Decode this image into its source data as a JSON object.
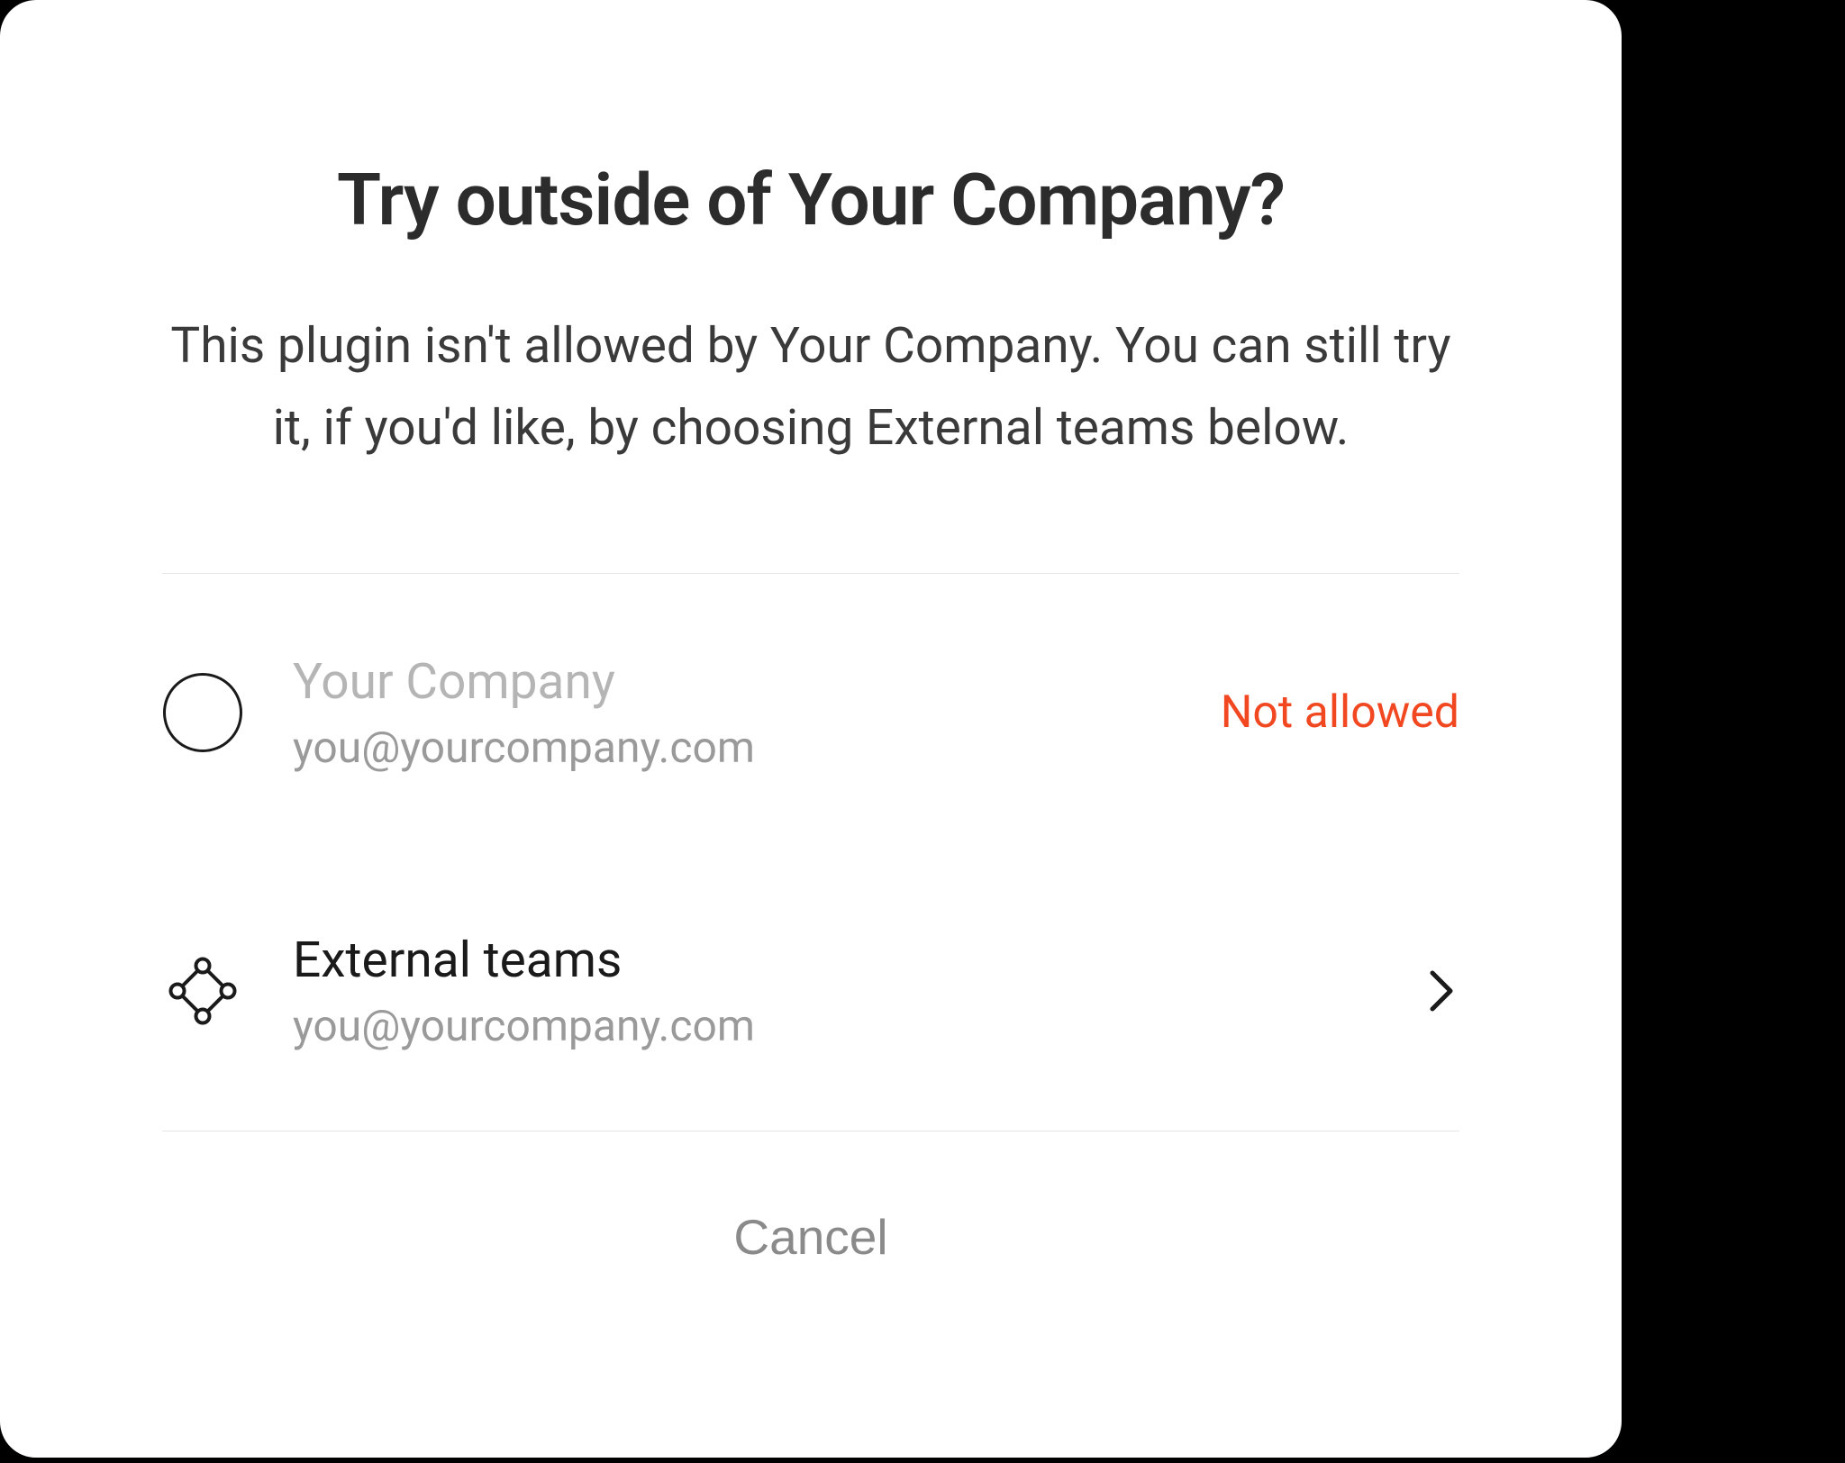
{
  "modal": {
    "title": "Try outside of Your Company?",
    "description": "This plugin isn't allowed by Your Company. You can still try it, if you'd like, by choosing External teams below.",
    "options": [
      {
        "icon": "circle",
        "title": "Your Company",
        "email": "you@yourcompany.com",
        "status": "Not allowed",
        "disabled": true
      },
      {
        "icon": "community",
        "title": "External teams",
        "email": "you@yourcompany.com",
        "status": null,
        "disabled": false
      }
    ],
    "cancel_label": "Cancel"
  },
  "colors": {
    "error": "#f24822",
    "text_primary": "#1a1a1a",
    "text_secondary": "#9a9a9a",
    "text_disabled": "#b5b5b5"
  }
}
